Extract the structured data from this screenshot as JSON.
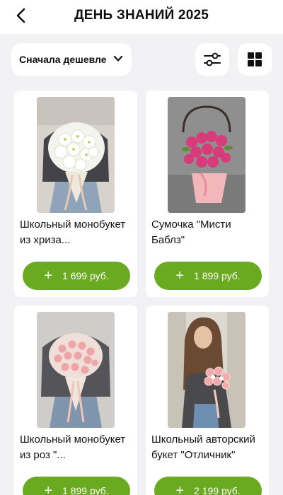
{
  "header": {
    "title": "ДЕНЬ ЗНАНИЙ 2025",
    "back_icon": "chevron-left-icon"
  },
  "toolbar": {
    "sort_label": "Сначала дешевле",
    "sort_icon": "chevron-down-icon",
    "filter_icon": "sliders-icon",
    "grid_icon": "grid-view-icon"
  },
  "products": [
    {
      "name": "Школьный монобукет из хриза...",
      "price": "1 699 руб.",
      "add_icon": "plus-icon"
    },
    {
      "name": "Сумочка \"Мисти Баблз\"",
      "price": "1 899 руб.",
      "add_icon": "plus-icon"
    },
    {
      "name": "Школьный монобукет из роз \"...",
      "price": "1 899 руб.",
      "add_icon": "plus-icon"
    },
    {
      "name": "Школьный авторский букет \"Отличник\"",
      "price": "2 199 руб.",
      "add_icon": "plus-icon"
    }
  ],
  "colors": {
    "accent_green": "#6aaa21",
    "background": "#f2f2f4",
    "card": "#ffffff",
    "text": "#111111"
  }
}
